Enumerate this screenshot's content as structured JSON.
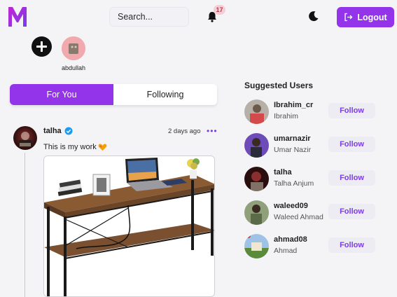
{
  "header": {
    "logo_letter": "M",
    "search_placeholder": "Search...",
    "notification_count": "17",
    "logout_label": "Logout",
    "accent_color": "#9333ea"
  },
  "stories": {
    "add_icon": "plus-circle-icon",
    "items": [
      {
        "username": "abdullah"
      }
    ]
  },
  "feed_tabs": [
    {
      "label": "For You",
      "active": true
    },
    {
      "label": "Following",
      "active": false
    }
  ],
  "post": {
    "username": "talha",
    "verified": true,
    "time": "2 days ago",
    "more_label": "•••",
    "text": "This is my work",
    "emoji_icon": "heart-party-emoji"
  },
  "suggested": {
    "title": "Suggested Users",
    "follow_label": "Follow",
    "users": [
      {
        "username": "Ibrahim_cr",
        "full_name": "Ibrahim"
      },
      {
        "username": "umarnazir",
        "full_name": "Umar Nazir"
      },
      {
        "username": "talha",
        "full_name": "Talha Anjum"
      },
      {
        "username": "waleed09",
        "full_name": "Waleed Ahmad"
      },
      {
        "username": "ahmad08",
        "full_name": "Ahmad"
      }
    ]
  }
}
